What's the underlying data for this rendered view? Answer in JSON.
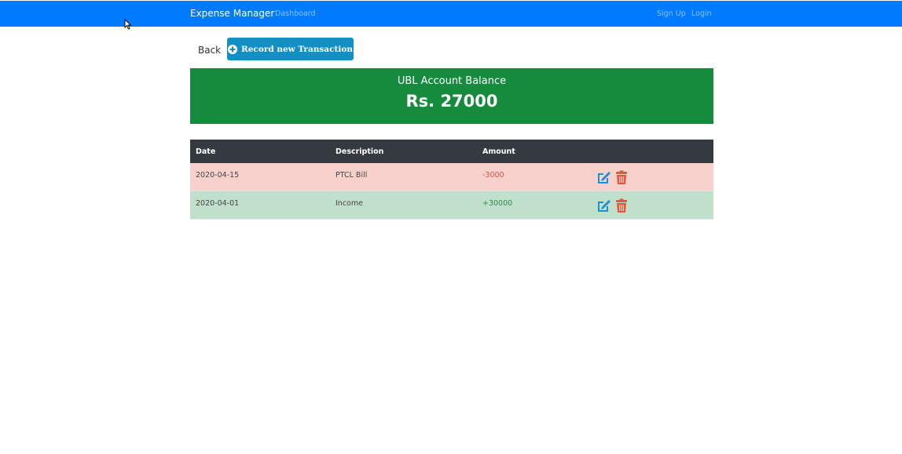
{
  "navbar": {
    "brand": "Expense Manager",
    "dashboard": "Dashboard",
    "signup": "Sign Up",
    "login": "Login"
  },
  "actions": {
    "back": "Back",
    "record": "Record new Transaction"
  },
  "balance": {
    "title": "UBL Account Balance",
    "amount": "Rs. 27000"
  },
  "table": {
    "headers": {
      "date": "Date",
      "description": "Description",
      "amount": "Amount"
    },
    "rows": [
      {
        "date": "2020-04-15",
        "description": "PTCL Bill",
        "amount": "-3000",
        "type": "debit"
      },
      {
        "date": "2020-04-01",
        "description": "Income",
        "amount": "+30000",
        "type": "credit"
      }
    ]
  },
  "icons": {
    "record": "plus-circle-icon",
    "edit": "edit-icon",
    "delete": "trash-icon"
  },
  "colors": {
    "navbar": "#007bff",
    "record_button": "#138fc4",
    "balance_card": "#168a3d",
    "table_header": "#343a40",
    "debit_row": "#f8d1cd",
    "credit_row": "#c1e0cc",
    "edit_icon": "#1a8fd6",
    "delete_icon": "#e8553f"
  }
}
